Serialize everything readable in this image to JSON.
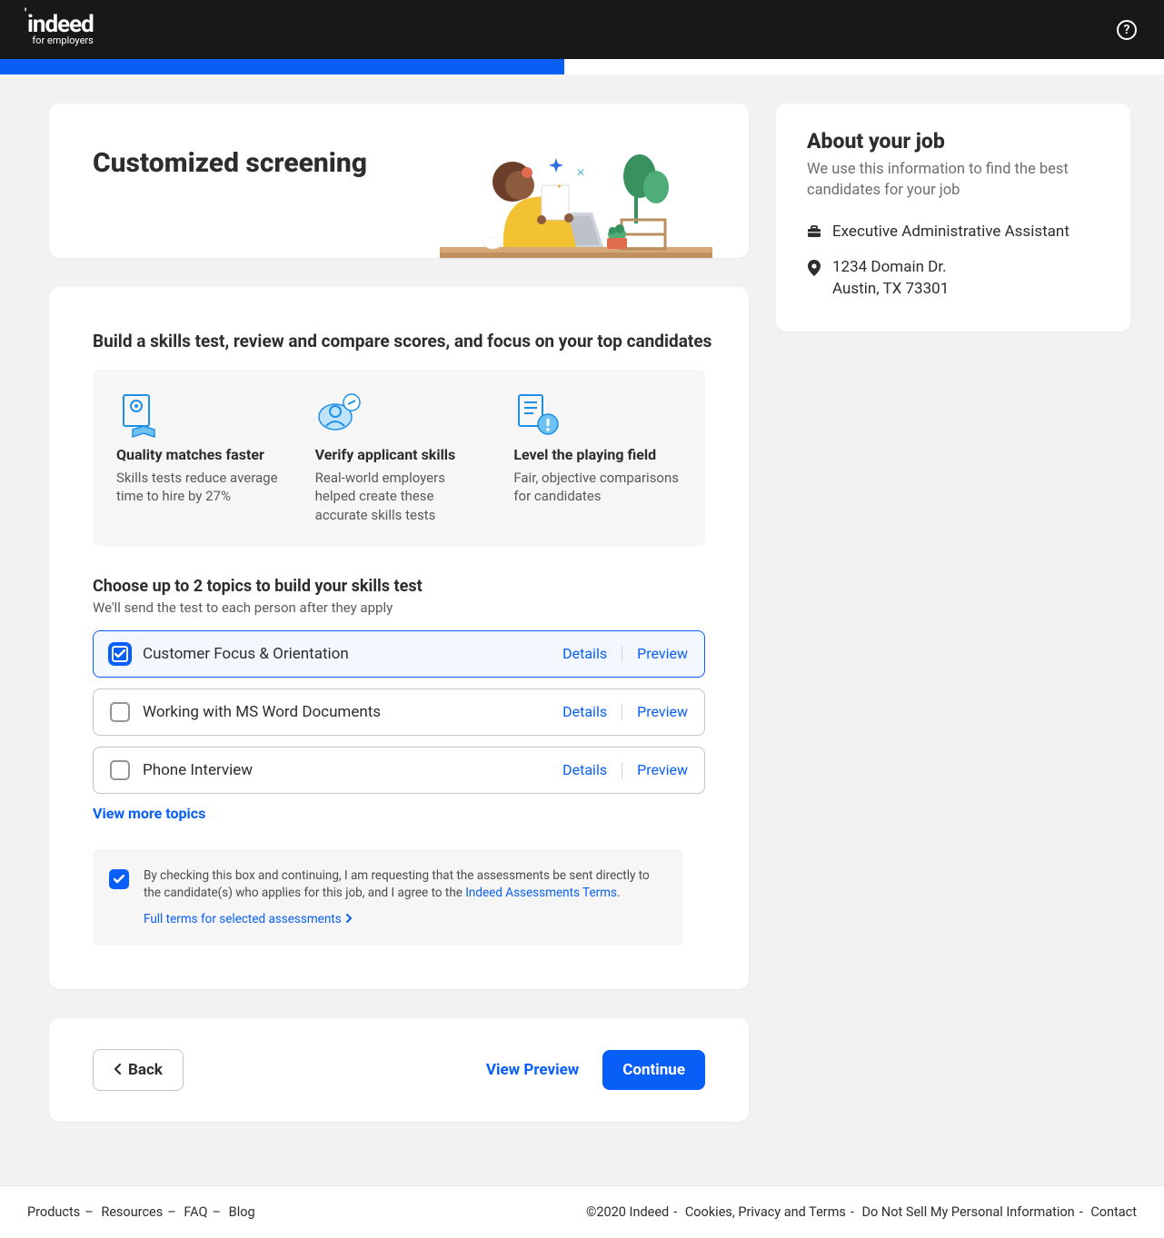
{
  "header": {
    "logo_main": "indeed",
    "logo_sub": "for employers"
  },
  "hero": {
    "title": "Customized screening"
  },
  "body": {
    "headline": "Build a skills test, review and compare scores, and focus on your top candidates",
    "benefits": [
      {
        "title": "Quality matches faster",
        "desc": "Skills tests reduce average time to hire by 27%"
      },
      {
        "title": "Verify applicant skills",
        "desc": "Real-world employers helped create these accurate skills tests"
      },
      {
        "title": "Level the playing field",
        "desc": "Fair, objective comparisons for candidates"
      }
    ],
    "choose_title": "Choose up to 2 topics to build your skills test",
    "choose_sub": "We'll send the test to each person after they apply",
    "topics": [
      {
        "label": "Customer Focus & Orientation",
        "details": "Details",
        "preview": "Preview",
        "checked": true
      },
      {
        "label": "Working with MS Word Documents",
        "details": "Details",
        "preview": "Preview",
        "checked": false
      },
      {
        "label": "Phone Interview",
        "details": "Details",
        "preview": "Preview",
        "checked": false
      }
    ],
    "view_more": "View more topics",
    "consent_text_a": "By checking this box and continuing, I am requesting that the assessments be sent directly to the candidate(s) who applies for this job, and I agree to the ",
    "consent_link": "Indeed Assessments Terms",
    "consent_text_b": ".",
    "full_terms": "Full terms for selected assessments"
  },
  "nav": {
    "back": "Back",
    "view_preview": "View Preview",
    "continue": "Continue"
  },
  "side": {
    "title": "About your job",
    "desc": "We use this information to find the best candidates for your job",
    "job_title": "Executive Administrative Assistant",
    "addr_line1": "1234 Domain Dr.",
    "addr_line2": "Austin, TX 73301"
  },
  "footer": {
    "left": {
      "products": "Products",
      "resources": "Resources",
      "faq": "FAQ",
      "blog": "Blog"
    },
    "right": {
      "copyright": "©2020 Indeed",
      "cookies": "Cookies, Privacy and Terms",
      "dns": "Do Not Sell My Personal Information",
      "contact": "Contact"
    }
  }
}
